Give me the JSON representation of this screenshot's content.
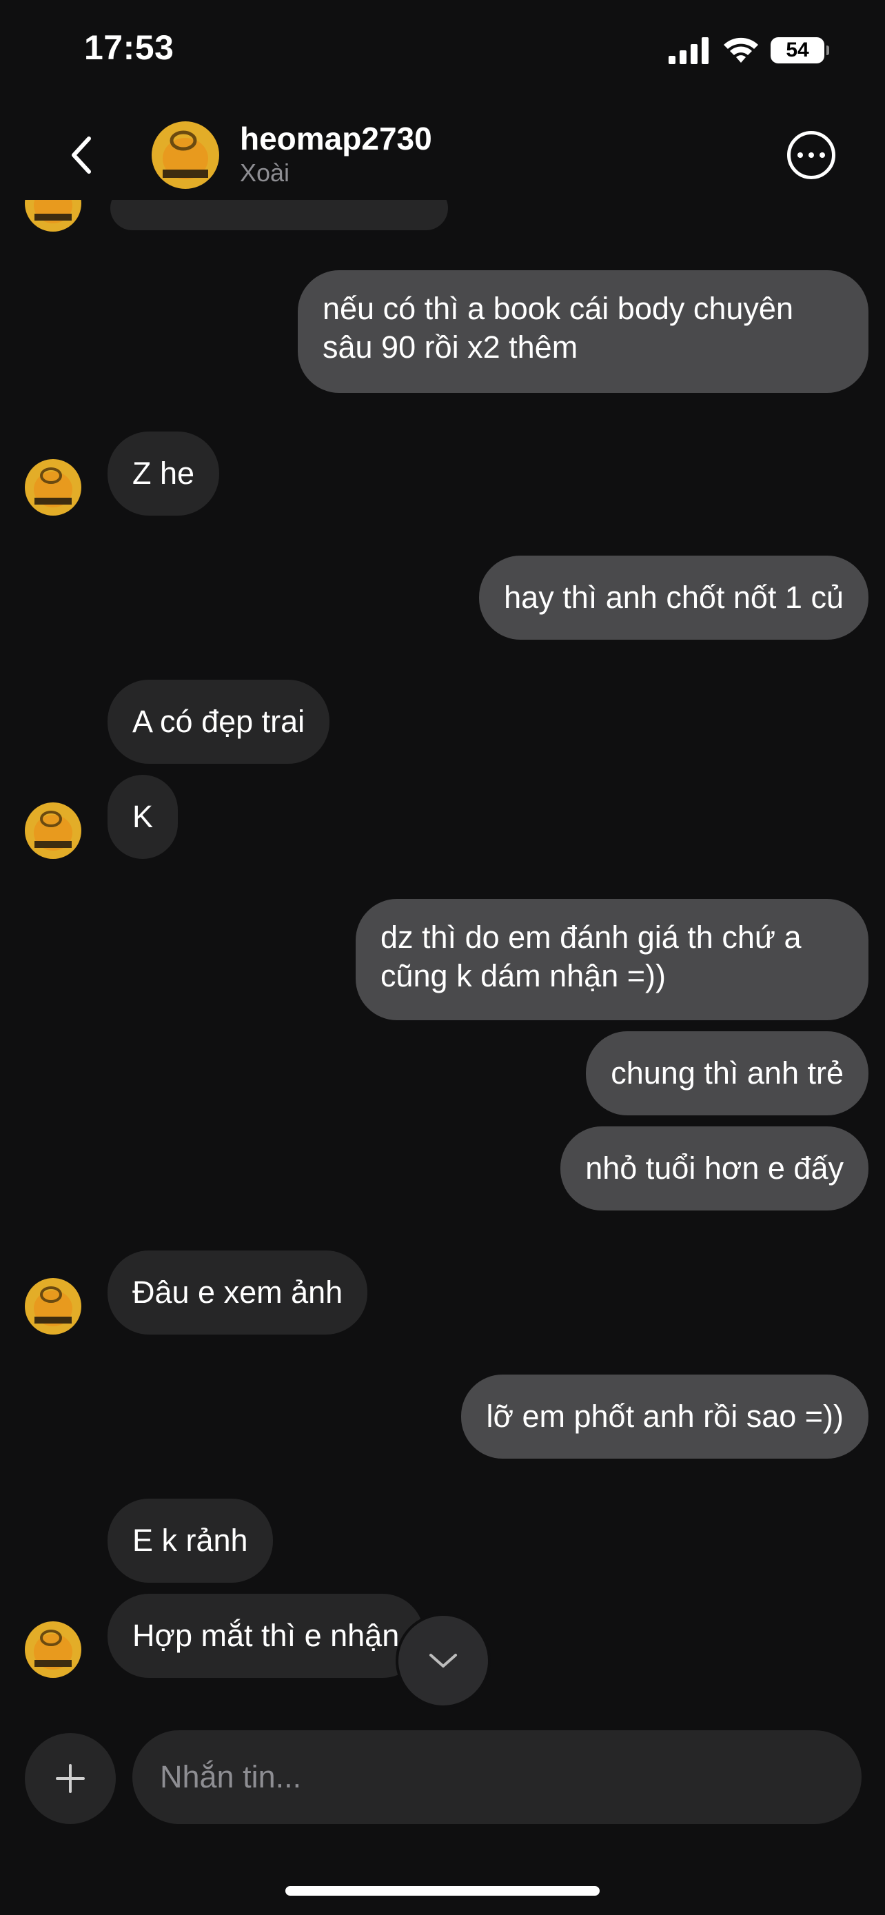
{
  "status_bar": {
    "time": "17:53",
    "battery": "54",
    "signal_icon": "cellular-signal-icon",
    "wifi_icon": "wifi-icon"
  },
  "header": {
    "username": "heomap2730",
    "subtitle": "Xoài",
    "back_icon": "chevron-left-icon",
    "more_icon": "more-options-icon"
  },
  "messages": [
    {
      "side": "out",
      "text": "nếu có thì a book cái body chuyên sâu 90 rồi x2 thêm"
    },
    {
      "side": "in",
      "text": "Z he"
    },
    {
      "side": "out",
      "text": "hay thì anh chốt nốt 1 củ"
    },
    {
      "side": "in",
      "text": "A có đẹp trai"
    },
    {
      "side": "in",
      "text": "K"
    },
    {
      "side": "out",
      "text": "dz thì do em đánh giá th chứ a cũng k dám nhận =))"
    },
    {
      "side": "out",
      "text": "chung thì anh trẻ"
    },
    {
      "side": "out",
      "text": "nhỏ tuổi hơn e đấy"
    },
    {
      "side": "in",
      "text": "Đâu e xem ảnh"
    },
    {
      "side": "out",
      "text": "lỡ em phốt anh rồi sao =))"
    },
    {
      "side": "in",
      "text": "E k rảnh"
    },
    {
      "side": "in",
      "text": "Hợp mắt thì e nhận"
    }
  ],
  "composer": {
    "placeholder": "Nhắn tin...",
    "attach_icon": "plus-icon",
    "scroll_icon": "chevron-down-icon"
  },
  "colors": {
    "background": "#0f0f10",
    "incoming_bubble": "#262627",
    "outgoing_bubble": "#4a4a4c",
    "secondary_text": "#8e8e93"
  }
}
